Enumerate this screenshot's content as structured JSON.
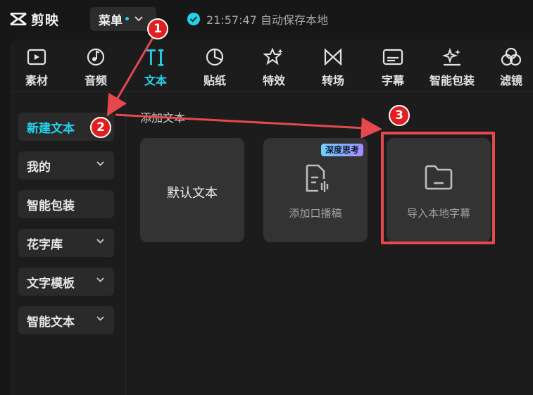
{
  "app": {
    "logo_text": "剪映",
    "menu_label": "菜单",
    "save_status": "21:57:47 自动保存本地"
  },
  "toolbar": {
    "tabs": [
      {
        "label": "素材",
        "icon": "media-icon"
      },
      {
        "label": "音频",
        "icon": "audio-icon"
      },
      {
        "label": "文本",
        "icon": "text-icon",
        "active": true
      },
      {
        "label": "贴纸",
        "icon": "sticker-icon"
      },
      {
        "label": "特效",
        "icon": "effects-icon"
      },
      {
        "label": "转场",
        "icon": "transition-icon"
      },
      {
        "label": "字幕",
        "icon": "subtitle-icon"
      },
      {
        "label": "智能包装",
        "icon": "smart-pack-icon"
      },
      {
        "label": "滤镜",
        "icon": "filter-icon"
      }
    ]
  },
  "sidebar": {
    "items": [
      {
        "label": "新建文本",
        "active": true
      },
      {
        "label": "我的"
      },
      {
        "label": "智能包装"
      },
      {
        "label": "花字库"
      },
      {
        "label": "文字模板"
      },
      {
        "label": "智能文本"
      }
    ]
  },
  "content": {
    "section_title": "添加文本",
    "cards": [
      {
        "label": "默认文本"
      },
      {
        "label": "添加口播稿",
        "badge": "深度思考",
        "icon": "script-icon"
      },
      {
        "label": "导入本地字幕",
        "icon": "folder-icon"
      }
    ]
  },
  "annotations": {
    "steps": [
      "1",
      "2",
      "3"
    ],
    "color": "#e02020"
  },
  "colors": {
    "accent": "#22d3ee",
    "highlight": "#e5484d"
  }
}
